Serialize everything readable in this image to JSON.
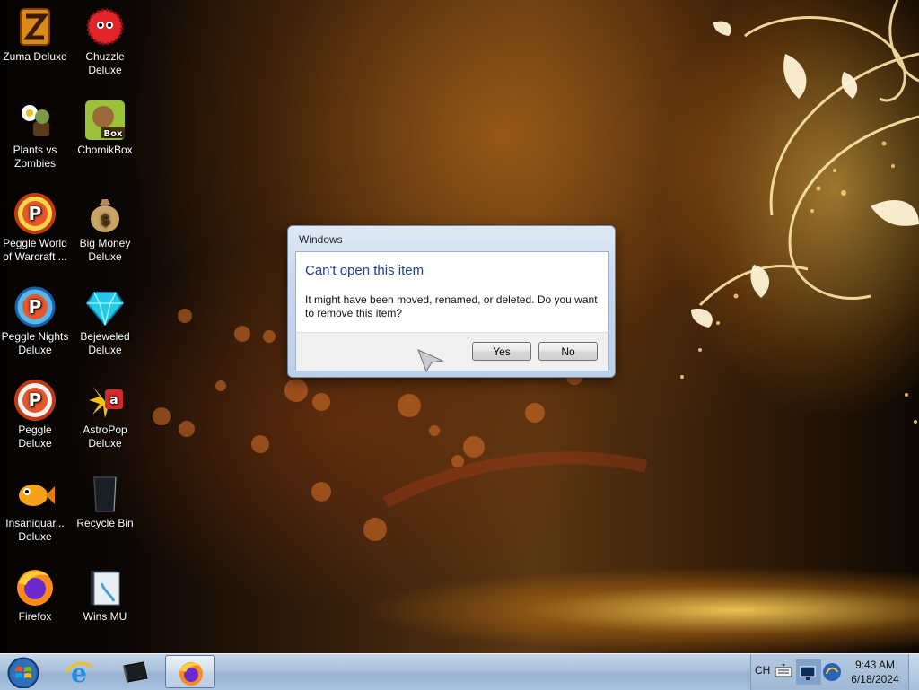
{
  "desktop": {
    "icons": [
      {
        "label": "Zuma Deluxe",
        "icon": "zuma-icon"
      },
      {
        "label": "Chuzzle\nDeluxe",
        "icon": "chuzzle-icon"
      },
      {
        "label": "Plants vs\nZombies",
        "icon": "plants-vs-zombies-icon"
      },
      {
        "label": "ChomikBox",
        "icon": "chomikbox-icon"
      },
      {
        "label": "Peggle World\nof Warcraft ...",
        "icon": "peggle-icon"
      },
      {
        "label": "Big Money\nDeluxe",
        "icon": "money-bag-icon"
      },
      {
        "label": "Peggle Nights\nDeluxe",
        "icon": "peggle-nights-icon"
      },
      {
        "label": "Bejeweled\nDeluxe",
        "icon": "gem-icon"
      },
      {
        "label": "Peggle Deluxe",
        "icon": "peggle-icon"
      },
      {
        "label": "AstroPop\nDeluxe",
        "icon": "astropop-icon"
      },
      {
        "label": "Insaniquar...\nDeluxe",
        "icon": "fish-icon"
      },
      {
        "label": "Recycle Bin",
        "icon": "recycle-bin-icon"
      },
      {
        "label": "Firefox",
        "icon": "firefox-icon"
      },
      {
        "label": "Wins MU",
        "icon": "folder-icon"
      }
    ]
  },
  "dialog": {
    "title": "Windows",
    "heading": "Can't open this item",
    "message": "It might have been moved, renamed, or deleted. Do you want to remove this item?",
    "yes_label": "Yes",
    "no_label": "No"
  },
  "taskbar": {
    "items": [
      "internet-explorer-icon",
      "terminal-icon",
      "firefox-icon"
    ],
    "active_item": "firefox-icon",
    "tray": {
      "language": "CH",
      "time": "9:43 AM",
      "date": "6/18/2024"
    }
  },
  "colors": {
    "dialog_heading": "#1e3f91",
    "taskbar": "#a9c0da"
  }
}
